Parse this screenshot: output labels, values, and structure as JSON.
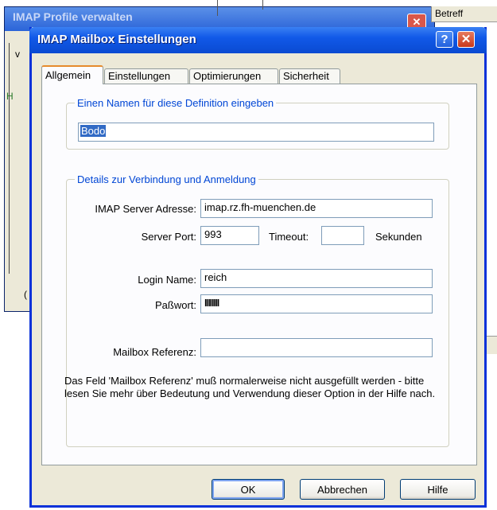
{
  "background_window": {
    "title": "IMAP Profile verwalten",
    "letter_left_1": "v",
    "letter_left_2": "H",
    "letter_left_3": "(",
    "close_glyph": "✕"
  },
  "background_list": {
    "column_header": "Betreff"
  },
  "dialog": {
    "title": "IMAP Mailbox Einstellungen",
    "help_glyph": "?",
    "close_glyph": "✕"
  },
  "tabs": [
    {
      "label": "Allgemein",
      "active": true
    },
    {
      "label": "Einstellungen",
      "active": false
    },
    {
      "label": "Optimierungen",
      "active": false
    },
    {
      "label": "Sicherheit",
      "active": false
    }
  ],
  "name_group": {
    "legend": "Einen Namen für diese Definition eingeben",
    "value": "Bodo"
  },
  "details_group": {
    "legend": "Details zur Verbindung und Anmeldung",
    "server_label": "IMAP Server Adresse:",
    "server_value": "imap.rz.fh-muenchen.de",
    "port_label": "Server Port:",
    "port_value": "993",
    "timeout_label": "Timeout:",
    "timeout_value": "",
    "timeout_unit": "Sekunden",
    "login_label": "Login Name:",
    "login_value": "reich",
    "password_label": "Paßwort:",
    "password_mask": "IIIIIII",
    "mailbox_ref_label": "Mailbox Referenz:",
    "mailbox_ref_value": "",
    "note": "Das Feld 'Mailbox Referenz' muß normalerweise nicht ausgefüllt werden - bitte lesen Sie mehr über Bedeutung und Verwendung dieser Option in der Hilfe nach."
  },
  "buttons": {
    "ok": "OK",
    "cancel": "Abbrechen",
    "help": "Hilfe"
  },
  "colors": {
    "title_blue": "#0a4ad1",
    "legend_blue": "#0046d5",
    "tab_highlight": "#e68b2c",
    "dialog_bg": "#ece9d8"
  }
}
